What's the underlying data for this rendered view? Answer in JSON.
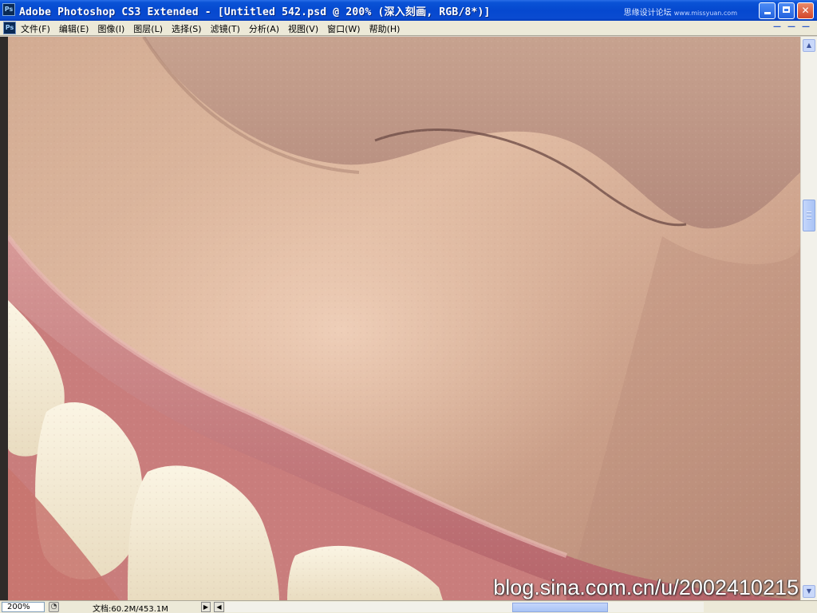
{
  "titlebar": {
    "icon_label": "Ps",
    "title": "Adobe Photoshop CS3 Extended - [Untitled 542.psd @ 200% (深入刻画, RGB/8*)]",
    "site_mark": "思缘设计论坛",
    "site_url": "www.missyuan.com"
  },
  "menubar": {
    "icon_label": "Ps",
    "items": [
      "文件(F)",
      "编辑(E)",
      "图像(I)",
      "图层(L)",
      "选择(S)",
      "滤镜(T)",
      "分析(A)",
      "视图(V)",
      "窗口(W)",
      "帮助(H)"
    ]
  },
  "canvas": {
    "watermark": "blog.sina.com.cn/u/2002410215"
  },
  "statusbar": {
    "zoom": "200%",
    "doc_info": "文档:60.2M/453.1M"
  },
  "icons": {
    "minimize": "minimize-icon",
    "maximize": "maximize-icon",
    "close": "close-icon"
  }
}
